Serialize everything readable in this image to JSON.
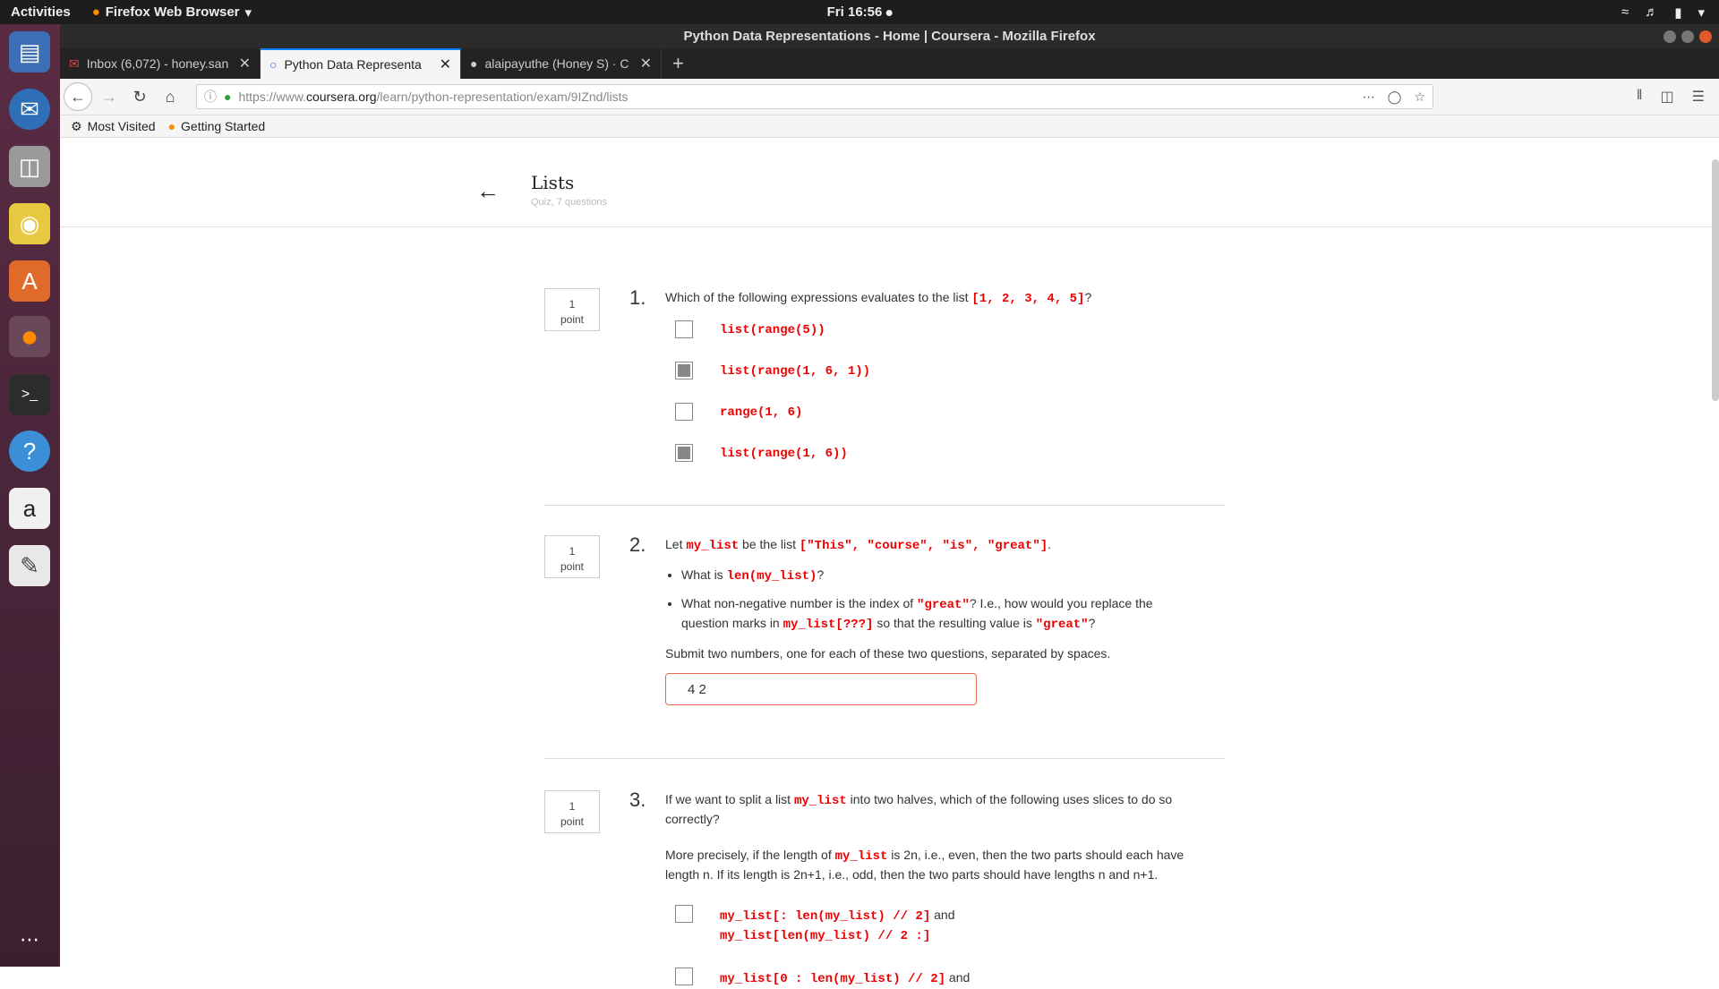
{
  "system": {
    "activities": "Activities",
    "app_menu": "Firefox Web Browser",
    "clock": "Fri 16:56"
  },
  "window": {
    "title": "Python Data Representations - Home | Coursera - Mozilla Firefox",
    "tabs": [
      {
        "label": "Inbox (6,072) - honey.san"
      },
      {
        "label": "Python Data Representa"
      },
      {
        "label": "alaipayuthe (Honey S) · C"
      }
    ],
    "url_prefix": "https://www.",
    "url_domain": "coursera.org",
    "url_path": "/learn/python-representation/exam/9IZnd/lists",
    "bookmarks": [
      "Most Visited",
      "Getting Started"
    ]
  },
  "quiz": {
    "title": "Lists",
    "subtitle": "Quiz, 7 questions",
    "point_number": "1",
    "point_label": "point"
  },
  "q1": {
    "num": "1.",
    "text": "Which of the following expressions evaluates to the list ",
    "code": "[1, 2, 3, 4, 5]",
    "end": "?",
    "options": [
      {
        "label": "list(range(5))",
        "checked": false
      },
      {
        "label": "list(range(1, 6, 1))",
        "checked": true
      },
      {
        "label": "range(1, 6)",
        "checked": false
      },
      {
        "label": "list(range(1, 6))",
        "checked": true
      }
    ]
  },
  "q2": {
    "num": "2.",
    "t1": "Let ",
    "c1": "my_list",
    "t2": " be the list ",
    "c2": "[\"This\", \"course\", \"is\", \"great\"]",
    "t3": ".",
    "b1_t1": "What is ",
    "b1_c1": "len(my_list)",
    "b1_t2": "?",
    "b2_t1": "What non-negative number is the index of ",
    "b2_c1": "\"great\"",
    "b2_t2": "? I.e., how would you replace the question marks in ",
    "b2_c2": "my_list[???]",
    "b2_t3": " so that the resulting value is ",
    "b2_c3": "\"great\"",
    "b2_t4": "?",
    "submit_text": "Submit two numbers, one for each of these two questions, separated by spaces.",
    "answer": "4 2"
  },
  "q3": {
    "num": "3.",
    "t1": "If we want to split a list ",
    "c1": "my_list",
    "t2": " into two halves, which of the following uses slices to do so correctly?",
    "p2_t1": "More precisely, if the length of ",
    "p2_c1": "my_list",
    "p2_t2": " is 2n, i.e., even, then the two parts should each have length n. If its length is 2n+1, i.e., odd, then the two parts should have lengths n and n+1.",
    "opt1_a": "my_list[: len(my_list) // 2]",
    "opt1_and": " and",
    "opt1_b": "my_list[len(my_list) // 2 :]",
    "opt2_a": "my_list[0 : len(my_list) // 2]",
    "opt2_and": " and"
  }
}
